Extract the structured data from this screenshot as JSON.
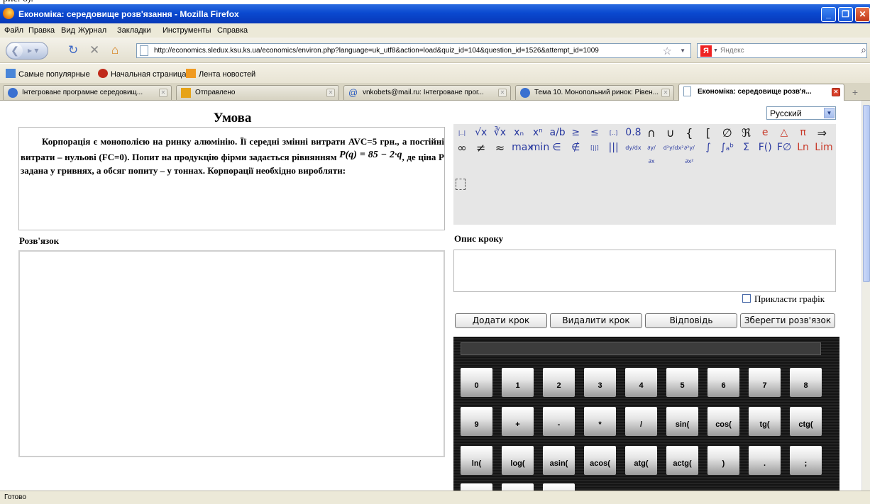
{
  "window": {
    "title": "Економіка: середовище розв'язання - Mozilla Firefox"
  },
  "menu": [
    "Файл",
    "Правка",
    "Вид",
    "Журнал",
    "Закладки",
    "Инструменты",
    "Справка"
  ],
  "nav": {
    "url": "http://economics.sledux.ksu.ks.ua/economics/environ.php?language=uk_utf8&action=load&quiz_id=104&question_id=1526&attempt_id=1009",
    "search_placeholder": "Яндекс",
    "search_engine_letter": "Я"
  },
  "bookmarks": [
    "Самые популярные",
    "Начальная страница",
    "Лента новостей"
  ],
  "tabs": [
    "Інтегроване програмне середовищ...",
    "Отправлено",
    "vnkobets@mail.ru: Інтегроване прог...",
    "Тема 10. Монопольний ринок: Рівен...",
    "Економіка: середовище розв'я..."
  ],
  "page": {
    "condition_title": "Умова",
    "problem_part1": "Корпорація є монополією на ринку алюмінію. Її середні змінні витрати AVC=5 грн., а постійні витрати – нульові (FC=0). Попит на продукцію фірми задається рівнянням",
    "problem_formula": "P(q) = 85 − 2·q",
    "problem_part2": ", де ціна P задана у гривнях, а обсяг попиту – у тоннах. Корпорації необхідно виробляти:",
    "solution_label": "Розв'язок",
    "step_desc_label": "Опис кроку",
    "attach_graph_label": "Прикласти графік",
    "language": "Русский",
    "buttons": {
      "add_step": "Додати крок",
      "delete_step": "Видалити крок",
      "answer": "Відповідь",
      "save": "Зберегти розв'язок"
    }
  },
  "math_toolbar": {
    "row1": [
      "|..|",
      "√x",
      "∛x",
      "xₙ",
      "xⁿ",
      "a/b",
      "≥",
      "≤",
      "[..]",
      "0.8",
      "∩",
      "∪",
      "{",
      "[",
      "∅",
      "ℜ",
      "e",
      "△",
      "π",
      "⇒"
    ],
    "row2": [
      "∞",
      "≠",
      "≈",
      "max",
      "min",
      "∈",
      "∉",
      "[||]",
      "|||",
      "dy/dx",
      "∂y/∂x",
      "d²y/dx²",
      "∂²y/∂x²",
      "∫",
      "∫ₐᵇ",
      "Σ",
      "F()",
      "F∅",
      "Ln",
      "Lim"
    ]
  },
  "calculator": {
    "row1": [
      "0",
      "1",
      "2",
      "3",
      "4",
      "5",
      "6",
      "7",
      "8"
    ],
    "row2": [
      "9",
      "+",
      "-",
      "*",
      "/",
      "sin(",
      "cos(",
      "tg(",
      "ctg("
    ],
    "row3": [
      "ln(",
      "log(",
      "asin(",
      "acos(",
      "atg(",
      "actg(",
      ")",
      ".",
      ";"
    ]
  },
  "status": "Готово"
}
